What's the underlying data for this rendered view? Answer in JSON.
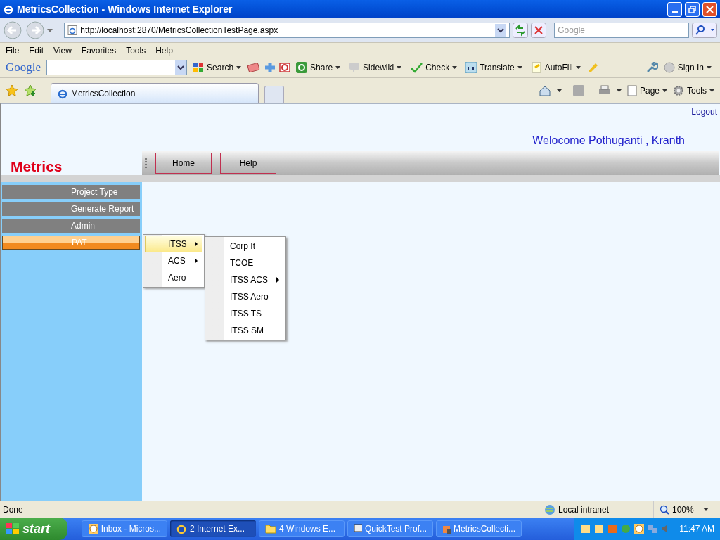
{
  "window": {
    "title": "MetricsCollection - Windows Internet Explorer"
  },
  "address_bar": {
    "url": "http://localhost:2870/MetricsCollectionTestPage.aspx",
    "search_placeholder": "Google"
  },
  "menu_bar": [
    "File",
    "Edit",
    "View",
    "Favorites",
    "Tools",
    "Help"
  ],
  "google_toolbar": {
    "logo": "Google",
    "items": [
      {
        "label": "Search"
      },
      {
        "label": "Share"
      },
      {
        "label": "Sidewiki"
      },
      {
        "label": "Check"
      },
      {
        "label": "Translate"
      },
      {
        "label": "AutoFill"
      },
      {
        "label": "Sign In"
      }
    ]
  },
  "tabs": [
    {
      "label": "MetricsCollection",
      "selected": true
    }
  ],
  "command_bar": [
    "Page",
    "Tools"
  ],
  "page": {
    "logout": "Logout",
    "welcome": "Welocome Pothuganti , Kranth",
    "logo": "Metrics",
    "nav": [
      "Home",
      "Help"
    ],
    "sidebar": [
      {
        "label": "Project Type",
        "selected": false
      },
      {
        "label": "Generate Report",
        "selected": false
      },
      {
        "label": "Admin",
        "selected": false
      },
      {
        "label": "PAT",
        "selected": true
      }
    ],
    "flyout": [
      {
        "label": "ITSS",
        "submenu": true,
        "selected": true
      },
      {
        "label": "ACS",
        "submenu": true,
        "selected": false
      },
      {
        "label": "Aero",
        "submenu": false,
        "selected": false
      }
    ],
    "submenu": [
      {
        "label": "Corp It",
        "submenu": false
      },
      {
        "label": "TCOE",
        "submenu": false
      },
      {
        "label": "ITSS ACS",
        "submenu": true
      },
      {
        "label": "ITSS Aero",
        "submenu": false
      },
      {
        "label": "ITSS TS",
        "submenu": false
      },
      {
        "label": "ITSS SM",
        "submenu": false
      }
    ]
  },
  "status_bar": {
    "text": "Done",
    "zone": "Local intranet",
    "zoom": "100%"
  },
  "taskbar": {
    "start": "start",
    "buttons": [
      {
        "label": "Inbox - Micros...",
        "selected": false
      },
      {
        "label": "2 Internet Ex...",
        "selected": true
      },
      {
        "label": "4 Windows E...",
        "selected": false
      },
      {
        "label": "QuickTest Prof...",
        "selected": false
      },
      {
        "label": "MetricsCollecti...",
        "selected": false
      }
    ],
    "clock": "11:47 AM"
  }
}
